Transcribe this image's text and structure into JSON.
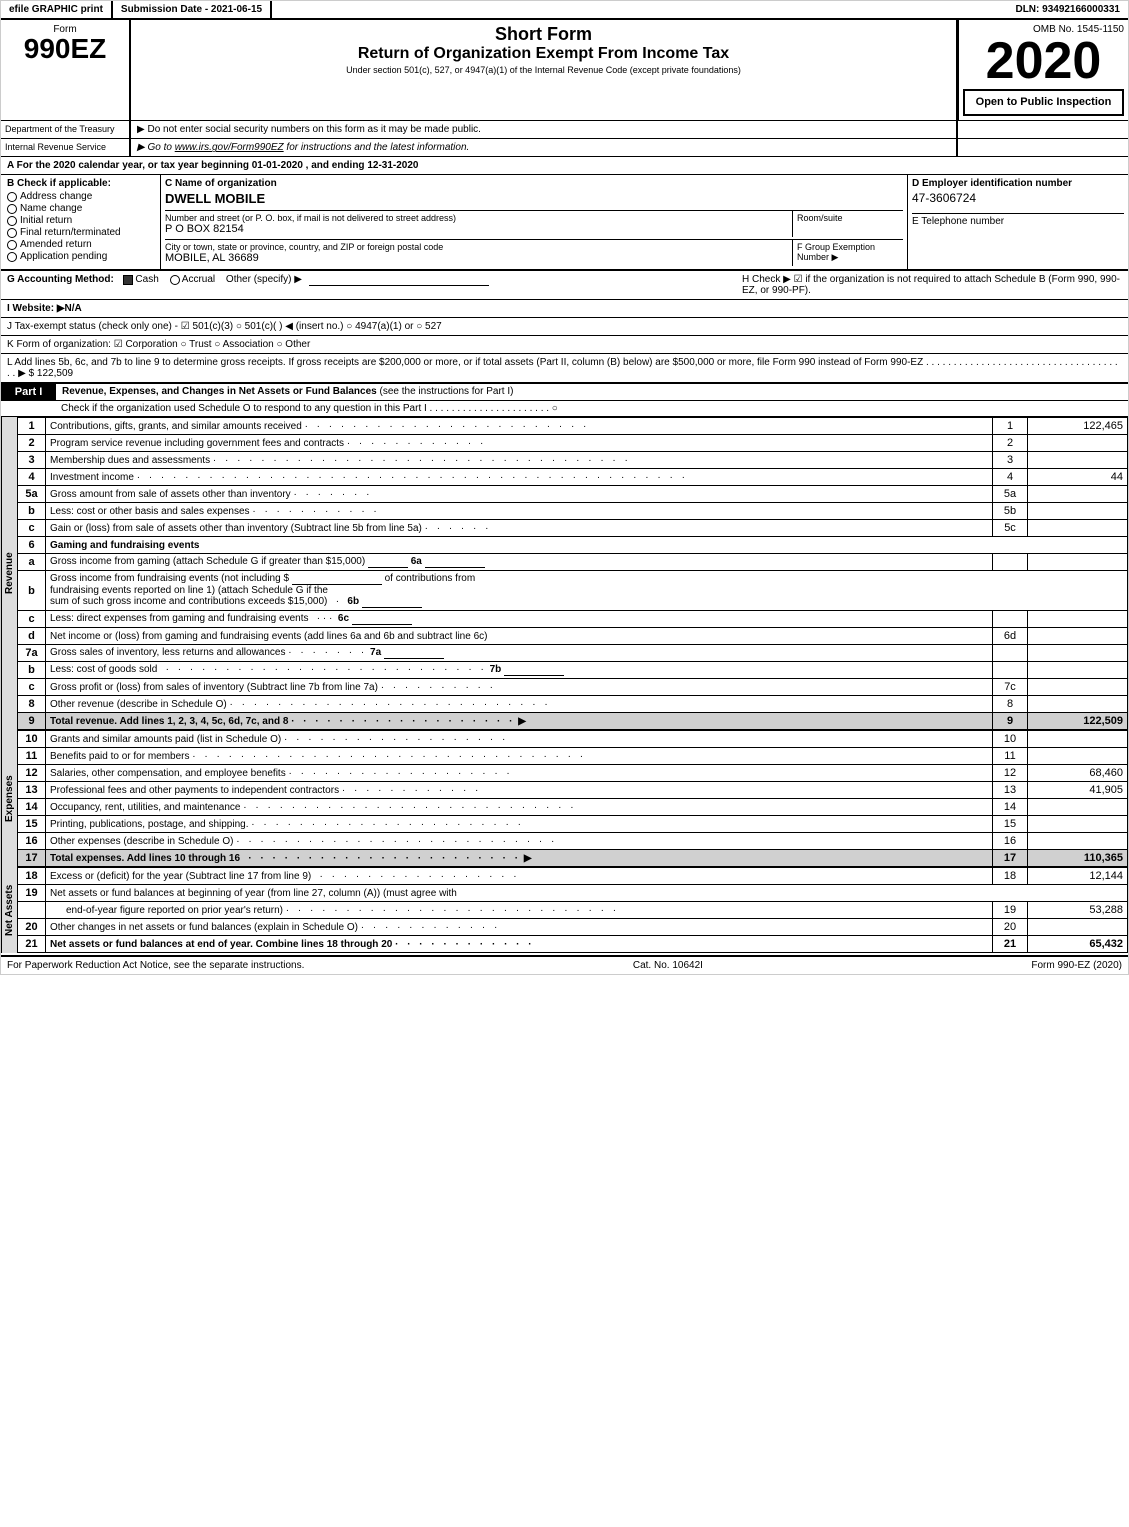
{
  "header": {
    "efile": "efile GRAPHIC print",
    "submission": "Submission Date - 2021-06-15",
    "dln": "DLN: 93492166000331",
    "form_label": "Form",
    "form_number": "990EZ",
    "title_line1": "Short Form",
    "title_line2": "Return of Organization Exempt From Income Tax",
    "subtitle": "Under section 501(c), 527, or 4947(a)(1) of the Internal Revenue Code (except private foundations)",
    "note1": "▶ Do not enter social security numbers on this form as it may be made public.",
    "note2": "▶ Go to www.irs.gov/Form990EZ for instructions and the latest information.",
    "omb": "OMB No. 1545-1150",
    "year": "2020",
    "open_label": "Open to\nPublic\nInspection",
    "dept1": "Department of the Treasury",
    "dept2": "Internal Revenue Service"
  },
  "section_a": {
    "text": "A  For the 2020 calendar year, or tax year beginning 01-01-2020 , and ending 12-31-2020"
  },
  "section_b": {
    "label": "B  Check if applicable:",
    "address_change": "Address change",
    "name_change": "Name change",
    "initial_return": "Initial return",
    "final_return": "Final return/terminated",
    "amended_return": "Amended return",
    "application_pending": "Application pending"
  },
  "section_c": {
    "label": "C  Name of organization",
    "org_name": "DWELL MOBILE",
    "street_label": "Number and street (or P. O. box, if mail is not delivered to street address)",
    "street": "P O BOX 82154",
    "room_label": "Room/suite",
    "city_label": "City or town, state or province, country, and ZIP or foreign postal code",
    "city": "MOBILE, AL  36689"
  },
  "section_d": {
    "label": "D  Employer identification number",
    "ein": "47-3606724"
  },
  "section_e": {
    "label": "E  Telephone number"
  },
  "section_f": {
    "label": "F  Group Exemption Number",
    "arrow": "▶"
  },
  "section_g": {
    "label": "G  Accounting Method:",
    "cash_checked": true,
    "cash": "Cash",
    "accrual": "Accrual",
    "other": "Other (specify) ▶"
  },
  "section_h": {
    "text": "H  Check ▶ ☑ if the organization is not required to attach Schedule B (Form 990, 990-EZ, or 990-PF)."
  },
  "section_i": {
    "label": "I  Website: ▶N/A"
  },
  "section_j": {
    "text": "J  Tax-exempt status (check only one) - ☑ 501(c)(3) ○ 501(c)(   ) ◀ (insert no.) ○ 4947(a)(1) or ○ 527"
  },
  "section_k": {
    "text": "K  Form of organization: ☑ Corporation  ○ Trust  ○ Association  ○ Other"
  },
  "section_l": {
    "text": "L  Add lines 5b, 6c, and 7b to line 9 to determine gross receipts. If gross receipts are $200,000 or more, or if total assets (Part II, column (B) below) are $500,000 or more, file Form 990 instead of Form 990-EZ . . . . . . . . . . . . . . . . . . . . . . . . . . . . . . . . . . . . . ▶ $ 122,509"
  },
  "part1": {
    "label": "Part I",
    "title": "Revenue, Expenses, and Changes in Net Assets or Fund Balances",
    "subtitle": "(see the instructions for Part I)",
    "schedule_check": "Check if the organization used Schedule O to respond to any question in this Part I . . . . . . . . . . . . . . . . . . . . . . ○",
    "lines": [
      {
        "num": "1",
        "desc": "Contributions, gifts, grants, and similar amounts received",
        "dots": "· · · · · · · · · · · · · · · · · · · · · · · ·",
        "ref": "1",
        "amount": "122,465"
      },
      {
        "num": "2",
        "desc": "Program service revenue including government fees and contracts",
        "dots": "· · · · · · · · · · · ·",
        "ref": "2",
        "amount": ""
      },
      {
        "num": "3",
        "desc": "Membership dues and assessments",
        "dots": "· · · · · · · · · · · · · · · · · · · · · · · · · · · · · · · · · · ·",
        "ref": "3",
        "amount": ""
      },
      {
        "num": "4",
        "desc": "Investment income",
        "dots": "· · · · · · · · · · · · · · · · · · · · · · · · · · · · · · · · · · · · · · · · · · · · · ·",
        "ref": "4",
        "amount": "44"
      },
      {
        "num": "5a",
        "desc": "Gross amount from sale of assets other than inventory · · · · · · ·",
        "dots": "",
        "ref": "5a",
        "amount": "",
        "sub": true
      },
      {
        "num": "5b",
        "desc": "Less: cost or other basis and sales expenses · · · · · · · · · · ·",
        "dots": "",
        "ref": "5b",
        "amount": "",
        "sub": true
      },
      {
        "num": "5c",
        "desc": "Gain or (loss) from sale of assets other than inventory (Subtract line 5b from line 5a) · · · · · ·",
        "dots": "",
        "ref": "5c",
        "amount": ""
      },
      {
        "num": "6",
        "desc": "Gaming and fundraising events",
        "dots": "",
        "ref": "",
        "amount": ""
      },
      {
        "num": "6a",
        "desc": "Gross income from gaming (attach Schedule G if greater than $15,000)",
        "dots": "",
        "ref": "6a",
        "amount": "",
        "sub": true
      },
      {
        "num": "6b",
        "desc": "Gross income from fundraising events (not including $",
        "dots": "",
        "ref": "",
        "amount": "",
        "sub": true,
        "special": "b_desc"
      },
      {
        "num": "6c",
        "desc": "Less: direct expenses from gaming and fundraising events · · ·",
        "dots": "",
        "ref": "6c",
        "amount": "",
        "sub": true
      },
      {
        "num": "6d",
        "desc": "Net income or (loss) from gaming and fundraising events (add lines 6a and 6b and subtract line 6c)",
        "dots": "",
        "ref": "6d",
        "amount": ""
      },
      {
        "num": "7a",
        "desc": "Gross sales of inventory, less returns and allowances · · · · · · ·",
        "dots": "",
        "ref": "7a",
        "amount": "",
        "sub": true
      },
      {
        "num": "7b",
        "desc": "Less: cost of goods sold · · · · · · · · · · · · · · · · · · · · · · · · · · ·",
        "dots": "",
        "ref": "7b",
        "amount": "",
        "sub": true
      },
      {
        "num": "7c",
        "desc": "Gross profit or (loss) from sales of inventory (Subtract line 7b from line 7a) · · · · · · · · · ·",
        "dots": "",
        "ref": "7c",
        "amount": ""
      },
      {
        "num": "8",
        "desc": "Other revenue (describe in Schedule O)",
        "dots": "· · · · · · · · · · · · · · · · · · · · · · · · · · ·",
        "ref": "8",
        "amount": ""
      },
      {
        "num": "9",
        "desc": "Total revenue. Add lines 1, 2, 3, 4, 5c, 6d, 7c, and 8",
        "dots": "· · · · · · · · · · · · · · · · · · ·",
        "ref": "9",
        "amount": "122,509",
        "total": true,
        "arrow": "▶"
      }
    ]
  },
  "part1_expenses": {
    "lines": [
      {
        "num": "10",
        "desc": "Grants and similar amounts paid (list in Schedule O)",
        "dots": "· · · · · · · · · · · · · · · · · · ·",
        "ref": "10",
        "amount": ""
      },
      {
        "num": "11",
        "desc": "Benefits paid to or for members",
        "dots": "· · · · · · · · · · · · · · · · · · · · · · · · · · · · · · · · ·",
        "ref": "11",
        "amount": ""
      },
      {
        "num": "12",
        "desc": "Salaries, other compensation, and employee benefits",
        "dots": "· · · · · · · · · · · · · · · · · · ·",
        "ref": "12",
        "amount": "68,460"
      },
      {
        "num": "13",
        "desc": "Professional fees and other payments to independent contractors",
        "dots": "· · · · · · · · · · · ·",
        "ref": "13",
        "amount": "41,905"
      },
      {
        "num": "14",
        "desc": "Occupancy, rent, utilities, and maintenance",
        "dots": "· · · · · · · · · · · · · · · · · · · · · · · · · · · ·",
        "ref": "14",
        "amount": ""
      },
      {
        "num": "15",
        "desc": "Printing, publications, postage, and shipping.",
        "dots": "· · · · · · · · · · · · · · · · · · · · · · ·",
        "ref": "15",
        "amount": ""
      },
      {
        "num": "16",
        "desc": "Other expenses (describe in Schedule O)",
        "dots": "· · · · · · · · · · · · · · · · · · · · · · · · · · ·",
        "ref": "16",
        "amount": ""
      },
      {
        "num": "17",
        "desc": "Total expenses. Add lines 10 through 16",
        "dots": "· · · · · · · · · · · · · · · · · · · · · · ·",
        "ref": "17",
        "amount": "110,365",
        "total": true,
        "arrow": "▶"
      }
    ]
  },
  "part1_netassets": {
    "lines": [
      {
        "num": "18",
        "desc": "Excess or (deficit) for the year (Subtract line 17 from line 9)",
        "dots": "· · · · · · · · · · · · · · · · · ·",
        "ref": "18",
        "amount": "12,144"
      },
      {
        "num": "19",
        "desc": "Net assets or fund balances at beginning of year (from line 27, column (A)) (must agree with",
        "dots": "",
        "ref": "",
        "amount": ""
      },
      {
        "num": "19b",
        "desc": "end-of-year figure reported on prior year's return) · · · · · · · · · · · · · · · · · · · · · · · · · · · ·",
        "dots": "",
        "ref": "19",
        "amount": "53,288",
        "sub": true
      },
      {
        "num": "20",
        "desc": "Other changes in net assets or fund balances (explain in Schedule O)",
        "dots": "· · · · · · · · · · · ·",
        "ref": "20",
        "amount": ""
      },
      {
        "num": "21",
        "desc": "Net assets or fund balances at end of year. Combine lines 18 through 20",
        "dots": "· · · · · · · · · · · ·",
        "ref": "21",
        "amount": "65,432"
      }
    ]
  },
  "footer": {
    "paperwork": "For Paperwork Reduction Act Notice, see the separate instructions.",
    "cat": "Cat. No. 10642I",
    "form": "Form 990-EZ (2020)"
  }
}
